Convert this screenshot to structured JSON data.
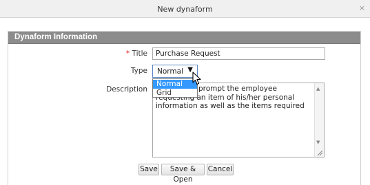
{
  "window": {
    "title": "New dynaform",
    "close_glyph": "×"
  },
  "panel": {
    "header": "Dynaform Information"
  },
  "form": {
    "title": {
      "required_mark": "*",
      "label": "Title",
      "value": "Purchase Request"
    },
    "type": {
      "label": "Type",
      "selected": "Normal",
      "arrow_glyph": "▼",
      "options": [
        "Normal",
        "Grid"
      ]
    },
    "description": {
      "label": "Description",
      "visible_text": "prompt the employee requesting an item of his/her personal information as well as the items required"
    }
  },
  "buttons": {
    "save": "Save",
    "save_open": "Save & Open",
    "cancel": "Cancel"
  }
}
